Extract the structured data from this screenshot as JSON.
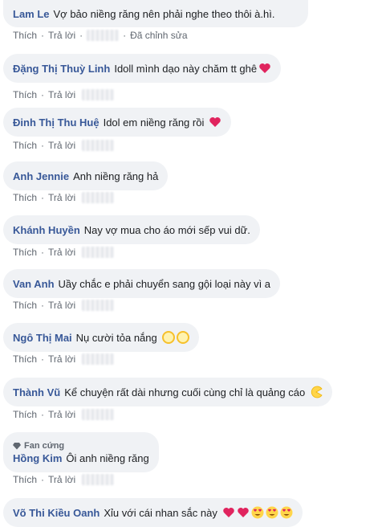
{
  "actions": {
    "like": "Thích",
    "reply": "Trả lời",
    "separator": "·"
  },
  "comments": [
    {
      "name": "Lam Le",
      "text": "Vợ bảo niềng răng nên phải nghe theo thôi à.hì.",
      "edited": "Đã chỉnh sửa"
    },
    {
      "name": "Đặng Thị Thuỳ Linh",
      "text": "Idoll mình dạo này chăm tt ghê",
      "emoji": [
        "heart-icon"
      ]
    },
    {
      "name": "Đinh Thị Thu Huệ",
      "text": "Idol em niềng răng rồi",
      "emoji": [
        "heart-icon"
      ]
    },
    {
      "name": "Anh Jennie",
      "text": "Anh niềng răng hả"
    },
    {
      "name": "Khánh Huyền",
      "text": "Nay vợ mua cho áo mới sếp vui dữ."
    },
    {
      "name": "Van Anh",
      "text": "Uầy chắc e phải chuyển sang gội loại này vì a"
    },
    {
      "name": "Ngô Thị Mai",
      "text": "Nụ cười tỏa nắng",
      "emoji": [
        "sun-face-icon",
        "sun-face-icon"
      ]
    },
    {
      "name": "Thành Vũ",
      "text": "Kể chuyện rất dài nhưng cuối cùng chỉ là quảng cáo",
      "emoji": [
        "pacman-icon"
      ]
    },
    {
      "name": "Hồng Kim",
      "badge": "Fan cứng",
      "text": "Ôi anh niềng răng"
    },
    {
      "name": "Võ Thi Kiều Oanh",
      "text": "Xỉu với cái nhan sắc này",
      "emoji": [
        "heart-icon",
        "heart-icon",
        "heart-eyes-icon",
        "heart-eyes-icon",
        "heart-eyes-icon"
      ]
    }
  ]
}
